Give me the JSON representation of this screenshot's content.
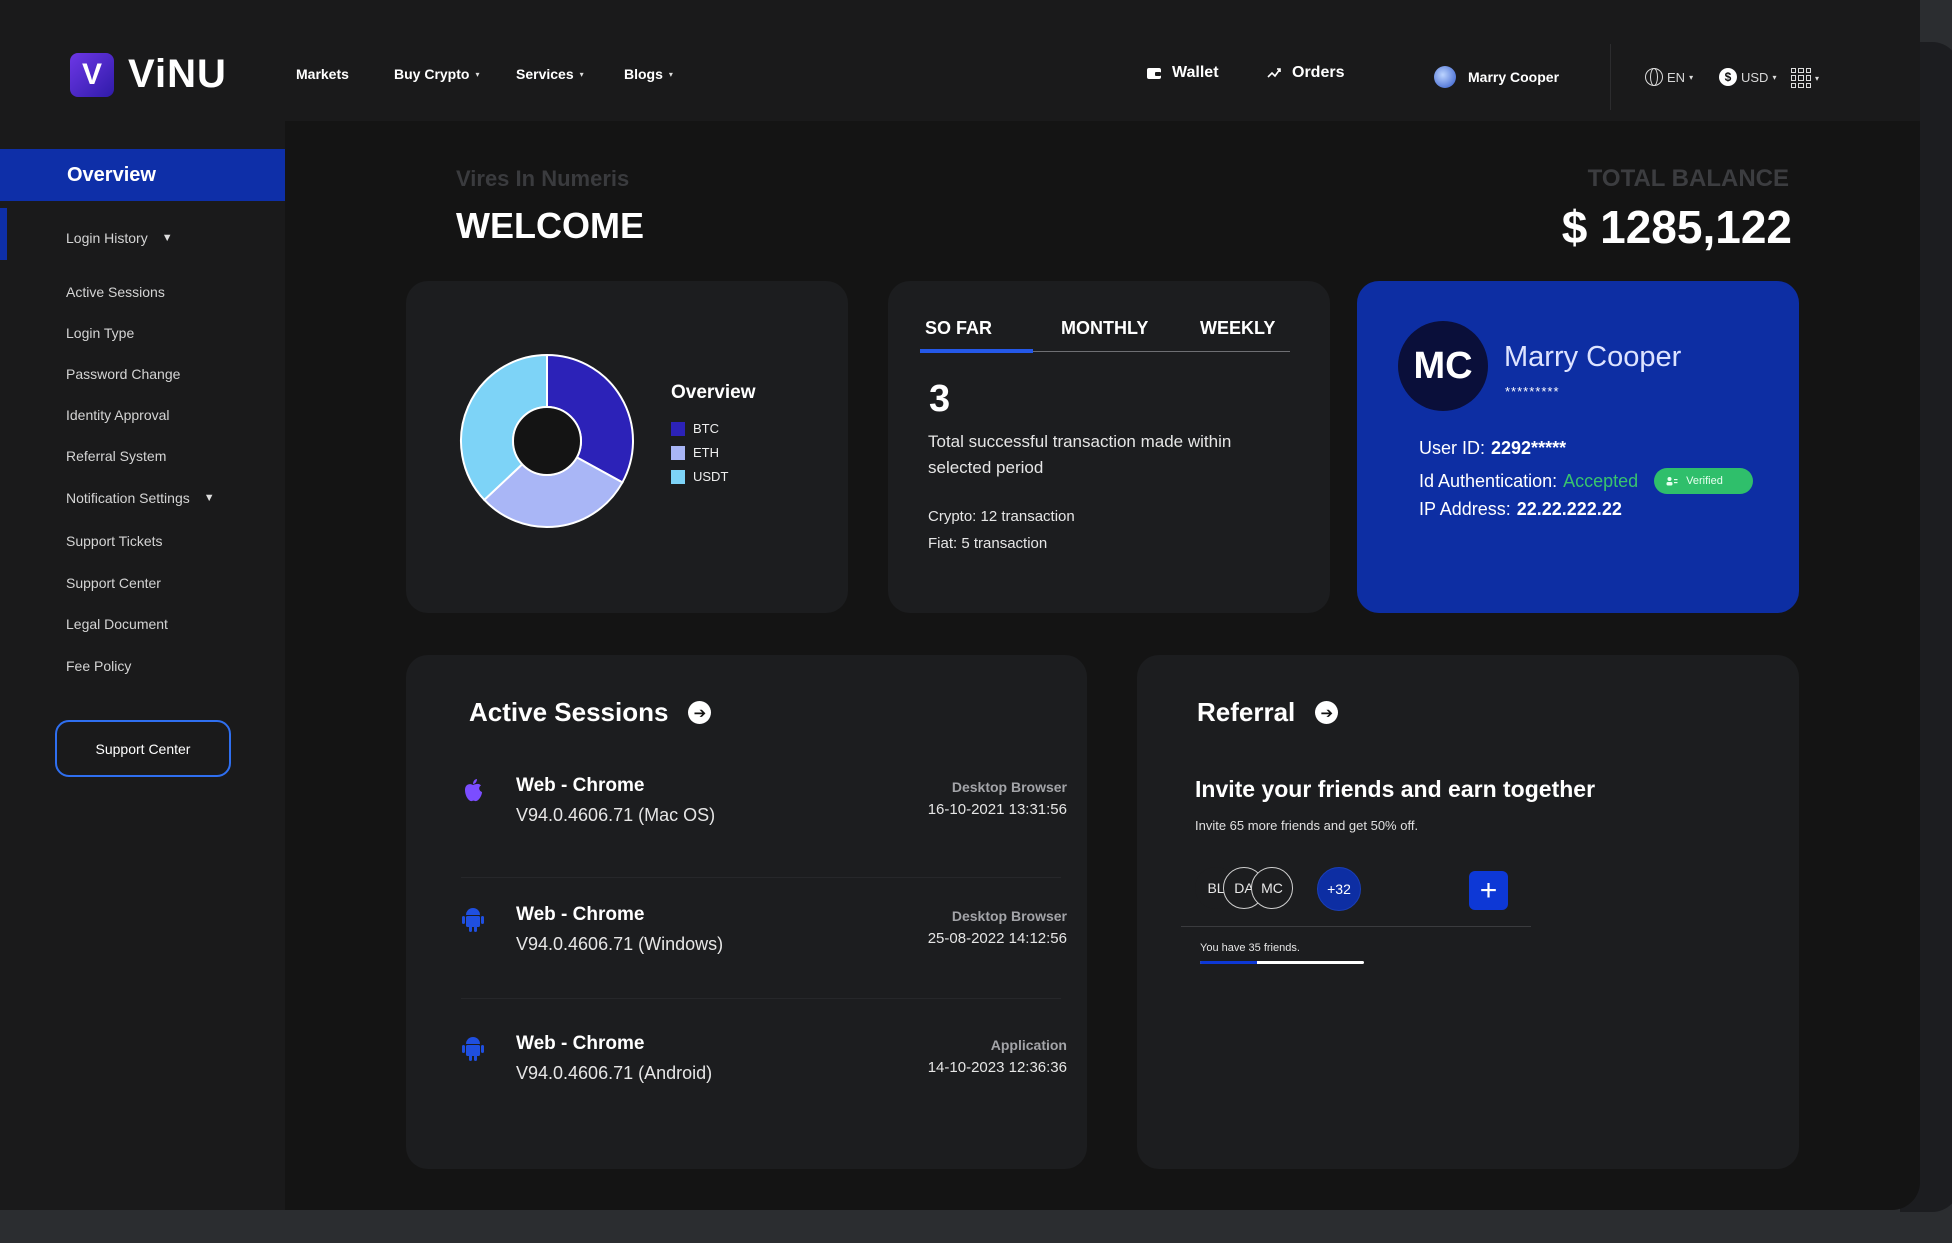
{
  "brand": {
    "name": "ViNU",
    "mark": "V"
  },
  "nav": {
    "items": [
      {
        "label": "Markets",
        "caret": false
      },
      {
        "label": "Buy Crypto",
        "caret": true
      },
      {
        "label": "Services",
        "caret": true
      },
      {
        "label": "Blogs",
        "caret": true
      }
    ],
    "wallet": "Wallet",
    "orders": "Orders",
    "user_name": "Marry Cooper",
    "language": "EN",
    "currency": "USD",
    "caret_glyph": "▾"
  },
  "sidebar": {
    "active": "Overview",
    "items": [
      {
        "label": "Login History",
        "caret": true
      },
      {
        "label": "Active Sessions"
      },
      {
        "label": "Login Type"
      },
      {
        "label": "Password Change"
      },
      {
        "label": "Identity Approval"
      },
      {
        "label": "Referral System"
      },
      {
        "label": "Notification Settings",
        "caret": true
      },
      {
        "label": "Support Tickets"
      },
      {
        "label": "Support Center"
      },
      {
        "label": "Legal Document"
      },
      {
        "label": "Fee Policy"
      }
    ],
    "caret_glyph": "▼",
    "support_button": "Support Center"
  },
  "header": {
    "subtitle": "Vires In Numeris",
    "title": "WELCOME",
    "balance_label": "TOTAL BALANCE",
    "balance_value": "$ 1285,122"
  },
  "chart_data": {
    "type": "pie",
    "title": "Overview",
    "donut": true,
    "categories": [
      "BTC",
      "ETH",
      "USDT"
    ],
    "values": [
      33,
      30,
      37
    ],
    "colors": [
      "#2c22b8",
      "#a9b6f6",
      "#7dd3f7"
    ]
  },
  "stats": {
    "tabs": [
      "SO FAR",
      "MONTHLY",
      "WEEKLY"
    ],
    "active_tab": "SO FAR",
    "count": "3",
    "description": "Total successful transaction made within selected period",
    "crypto": "Crypto: 12 transaction",
    "fiat": "Fiat: 5 transaction"
  },
  "profile": {
    "initials": "MC",
    "name": "Marry Cooper",
    "masked": "*********",
    "user_id_label": "User ID:",
    "user_id": "2292*****",
    "auth_label": "Id Authentication:",
    "auth_status": "Accepted",
    "verified_badge": "Verified",
    "ip_label": "IP Address:",
    "ip": "22.22.222.22"
  },
  "sessions": {
    "title": "Active Sessions",
    "arrow_glyph": "➔",
    "items": [
      {
        "icon": "apple-icon",
        "name": "Web - Chrome",
        "version": "V94.0.4606.71 (Mac OS)",
        "type": "Desktop Browser",
        "time": "16-10-2021 13:31:56"
      },
      {
        "icon": "android-icon",
        "name": "Web - Chrome",
        "version": "V94.0.4606.71 (Windows)",
        "type": "Desktop Browser",
        "time": "25-08-2022 14:12:56"
      },
      {
        "icon": "android-icon",
        "name": "Web - Chrome",
        "version": "V94.0.4606.71 (Android)",
        "type": "Application",
        "time": "14-10-2023 12:36:36"
      }
    ]
  },
  "referral": {
    "title": "Referral",
    "headline": "Invite your friends and earn together",
    "subline": "Invite 65 more friends and get 50% off.",
    "friends": [
      "BL",
      "DA",
      "MC"
    ],
    "more": "+32",
    "add_glyph": "+",
    "count_text": "You have 35 friends.",
    "progress": 0.35
  },
  "colors": {
    "accent": "#0d2ea3",
    "bright_accent": "#0d38d6",
    "success": "#2fbf6b",
    "panel": "#1c1d1f"
  }
}
